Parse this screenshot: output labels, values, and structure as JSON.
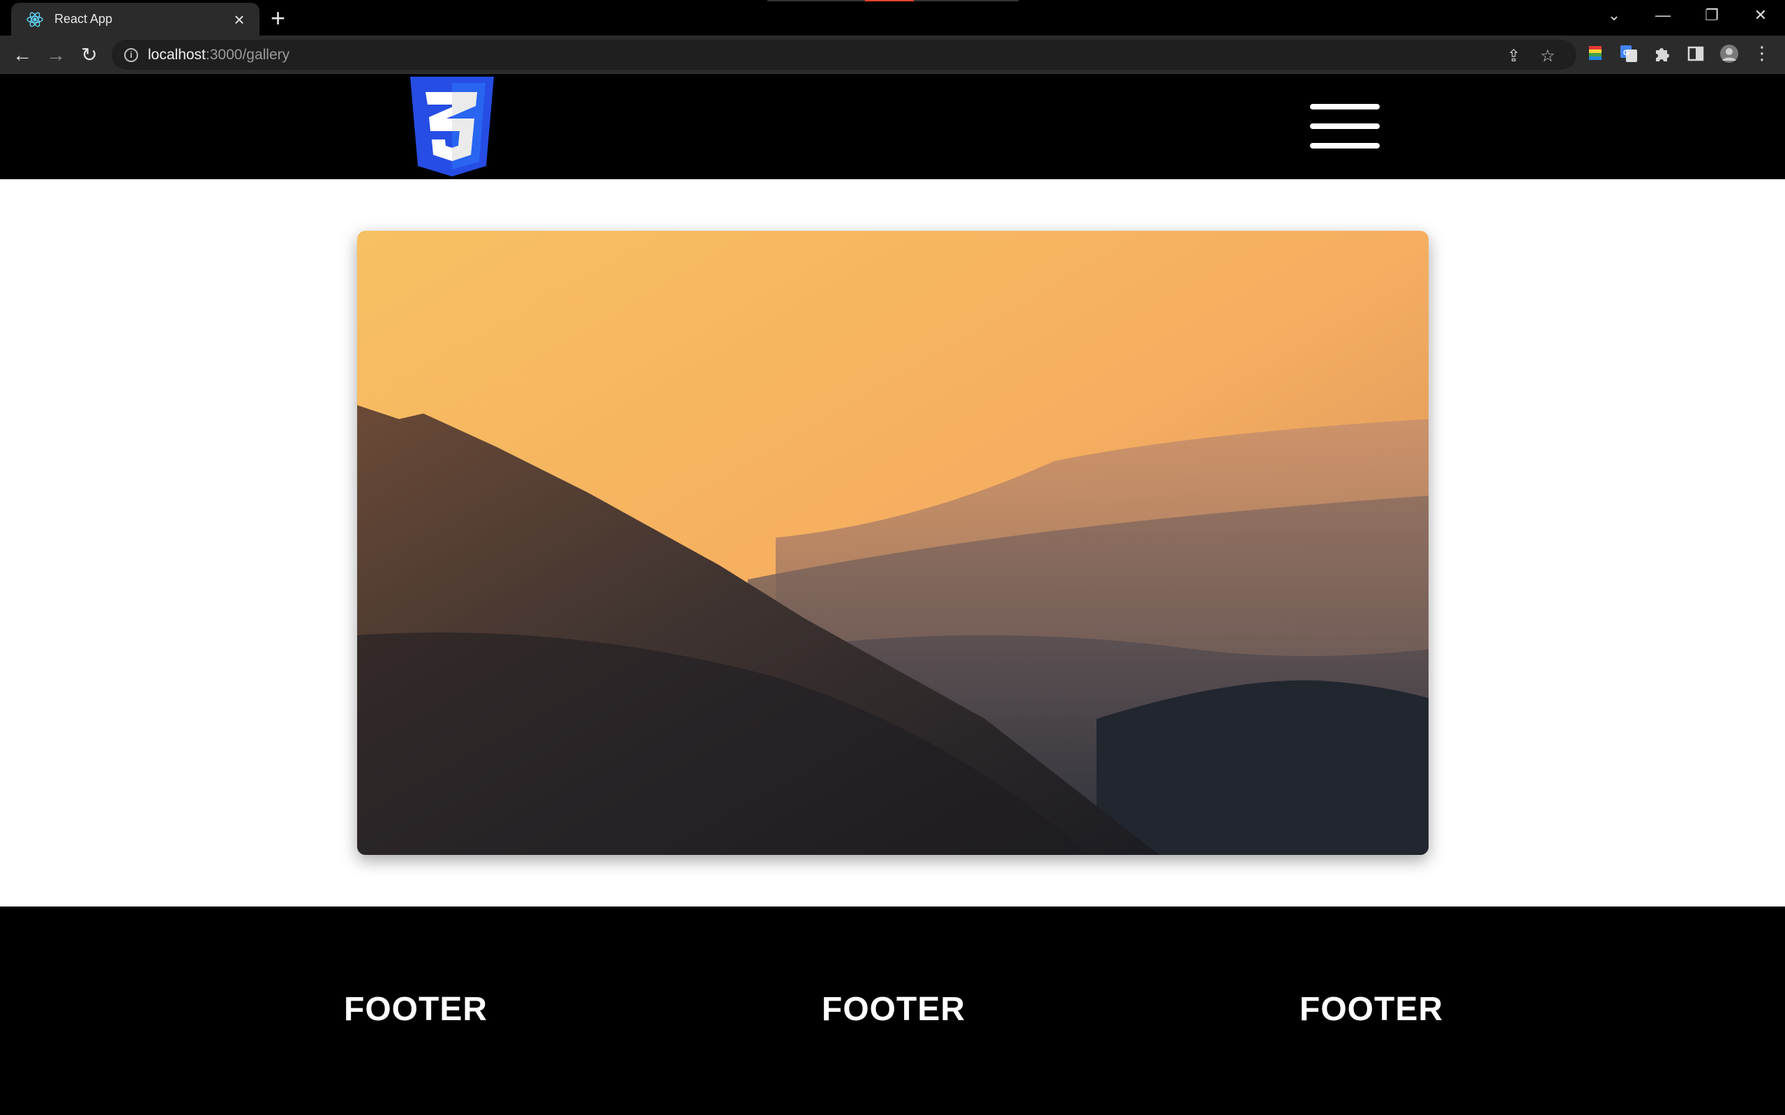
{
  "browser": {
    "tab_title": "React App",
    "url_host": "localhost",
    "url_path": ":3000/gallery",
    "window_controls": {
      "dropdown": "⌄",
      "minimize": "—",
      "restore": "❐",
      "close": "✕"
    }
  },
  "site": {
    "logo_icon": "css3-logo-icon",
    "menu_icon": "hamburger-menu-icon",
    "gallery_image": "mountain sunset landscape",
    "footer": [
      "FOOTER",
      "FOOTER",
      "FOOTER"
    ]
  },
  "colors": {
    "css3_blue": "#264de4",
    "css3_light_blue": "#2965f1",
    "header_bg": "#000000",
    "footer_bg": "#000000"
  }
}
